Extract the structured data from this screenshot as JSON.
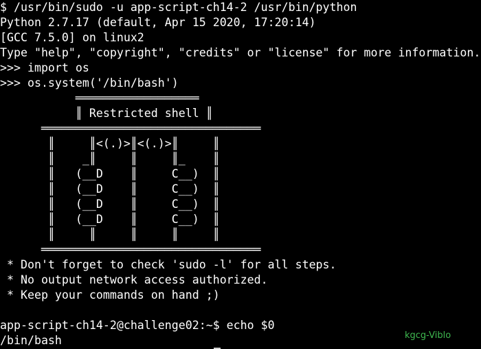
{
  "terminal": {
    "lines": [
      "$ /usr/bin/sudo -u app-script-ch14-2 /usr/bin/python",
      "Python 2.7.17 (default, Apr 15 2020, 17:20:14)",
      "[GCC 7.5.0] on linux2",
      "Type \"help\", \"copyright\", \"credits\" or \"license\" for more information.",
      ">>> import os",
      ">>> os.system('/bin/bash')",
      "           ══════════════════",
      "           ║ Restricted shell ║",
      "      ════════════════════════════════",
      "       ║     ║<(.)>║<(.)>║     ║",
      "       ║    _║     ║     ║_    ║",
      "       ║   (__D    ║     C__)  ║",
      "       ║   (__D    ║     C__)  ║",
      "       ║   (__D    ║     C__)  ║",
      "       ║   (__D    ║     C__)  ║",
      "       ║     ║     ║     ║     ║",
      "      ════════════════════════════════",
      " * Don't forget to check 'sudo -l' for all steps.",
      " * No output network access authorized.",
      " * Keep your commands on hand ;)",
      "",
      "app-script-ch14-2@challenge02:~$ echo $0",
      "/bin/bash"
    ],
    "text_color": "#ffffff",
    "background": "#000000"
  },
  "watermark": {
    "text": "kgcg-Viblo",
    "color": "#3fb950"
  }
}
